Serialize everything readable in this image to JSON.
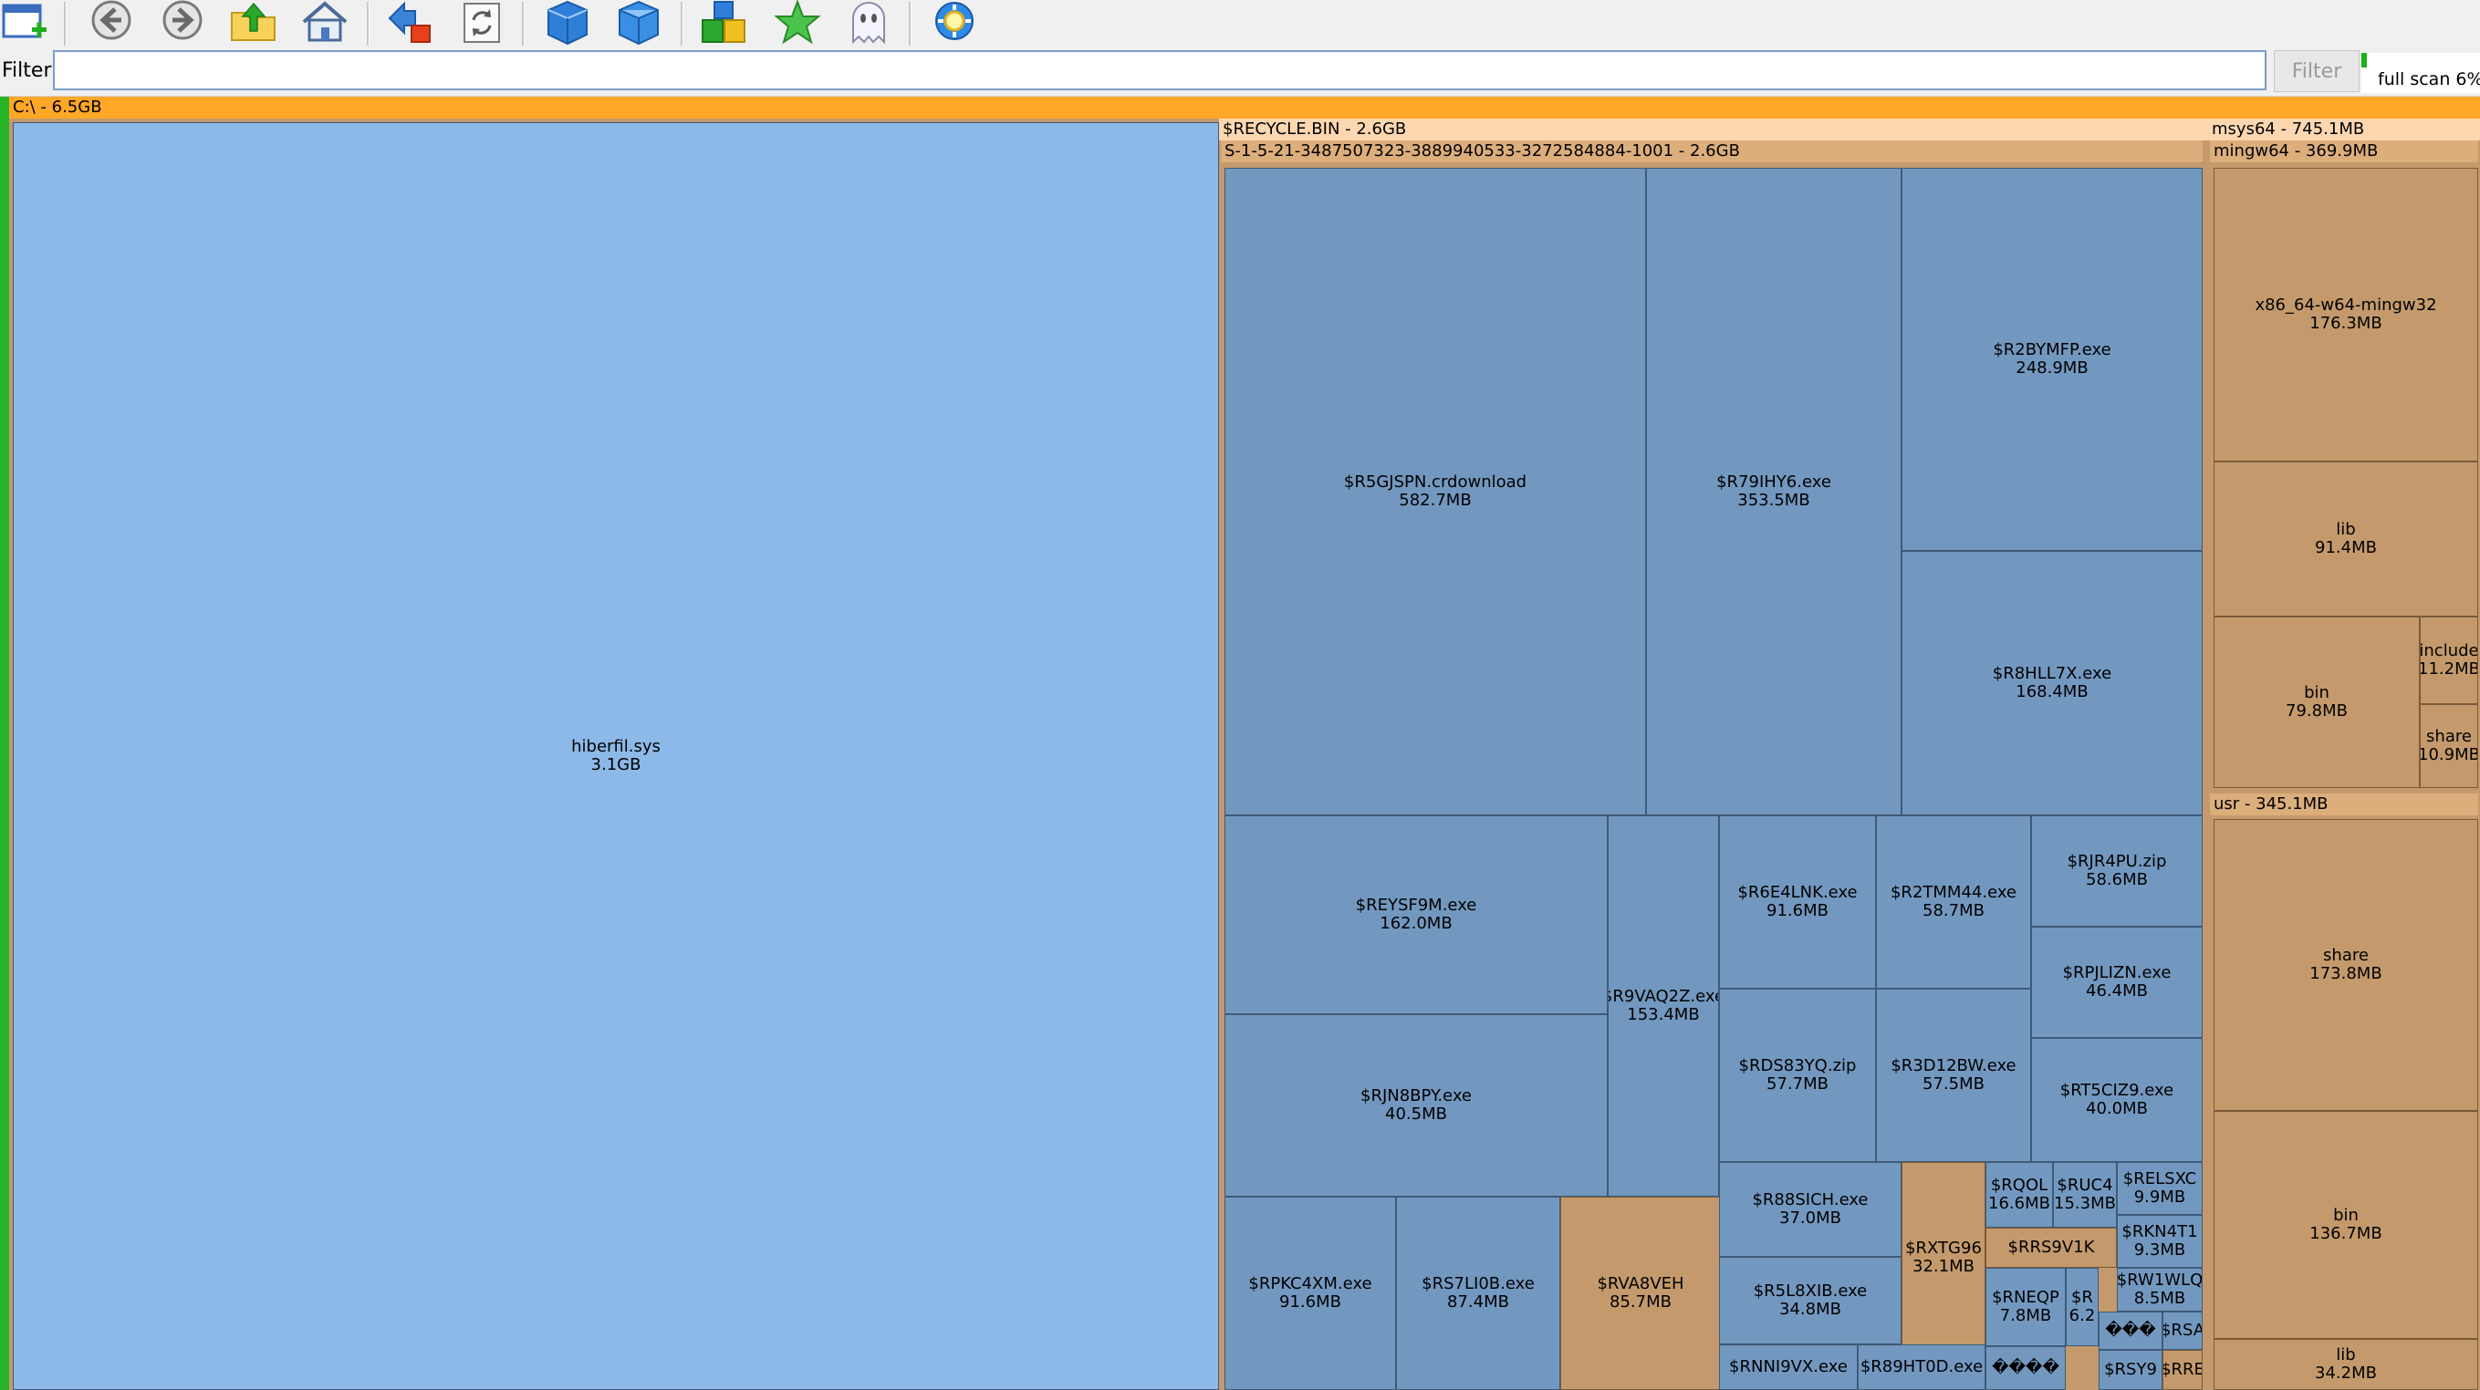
{
  "toolbar": {
    "buttons": [
      {
        "name": "new-window-button",
        "icon": "new-window-icon"
      },
      {
        "name": "back-button",
        "icon": "back-arrow-icon"
      },
      {
        "name": "forward-button",
        "icon": "forward-arrow-icon"
      },
      {
        "name": "up-button",
        "icon": "folder-up-icon"
      },
      {
        "name": "home-button",
        "icon": "home-icon"
      },
      {
        "name": "zoom-button",
        "icon": "zoom-icon"
      },
      {
        "name": "refresh-button",
        "icon": "refresh-icon"
      },
      {
        "name": "blue-cube-button",
        "icon": "cube-icon"
      },
      {
        "name": "blue-cube-open-button",
        "icon": "cube-open-icon"
      },
      {
        "name": "blocks-button",
        "icon": "blocks-icon"
      },
      {
        "name": "favorites-button",
        "icon": "star-icon"
      },
      {
        "name": "ghost-button",
        "icon": "ghost-icon"
      },
      {
        "name": "settings-button",
        "icon": "gear-icon"
      }
    ]
  },
  "filter": {
    "label": "Filter",
    "value": "",
    "placeholder": "",
    "button_label": "Filter"
  },
  "scan": {
    "label": "full scan 6%",
    "progress": 0.06
  },
  "colors": {
    "file_blue": "#8cb9e8",
    "folder_file_blue": "#7398c0",
    "tan": "#c49a6c",
    "header_orange": "#ffa726",
    "header_light": "#fdd7b0",
    "scan_green": "#19b219"
  },
  "treemap": {
    "root_header": "C:\\ - 6.5GB",
    "recycle_header": "$RECYCLE.BIN - 2.6GB",
    "sid_header": "S-1-5-21-3487507323-3889940533-3272584884-1001 - 2.6GB",
    "msys_header": "msys64 - 745.1MB",
    "mingw_header": "mingw64 - 369.9MB",
    "usr_header": "usr - 345.1MB",
    "cells": [
      {
        "name": "hiberfil.sys",
        "size": "3.1GB",
        "color": "blue"
      },
      {
        "name": "$R5GJSPN.crdownload",
        "size": "582.7MB",
        "color": "steel"
      },
      {
        "name": "$R79IHY6.exe",
        "size": "353.5MB",
        "color": "steel"
      },
      {
        "name": "$R2BYMFP.exe",
        "size": "248.9MB",
        "color": "steel"
      },
      {
        "name": "$R8HLL7X.exe",
        "size": "168.4MB",
        "color": "steel"
      },
      {
        "name": "$REYSF9M.exe",
        "size": "162.0MB",
        "color": "steel"
      },
      {
        "name": "$R9VAQ2Z.exe",
        "size": "153.4MB",
        "color": "steel"
      },
      {
        "name": "$R6E4LNK.exe",
        "size": "91.6MB",
        "color": "steel"
      },
      {
        "name": "$R2TMM44.exe",
        "size": "58.7MB",
        "color": "steel"
      },
      {
        "name": "$RJR4PU.zip",
        "size": "58.6MB",
        "color": "steel"
      },
      {
        "name": "$RPJLIZN.exe",
        "size": "46.4MB",
        "color": "steel"
      },
      {
        "name": "$RJN8BPY.exe",
        "size": "40.5MB",
        "color": "steel"
      },
      {
        "name": "$RDS83YQ.zip",
        "size": "57.7MB",
        "color": "steel"
      },
      {
        "name": "$R3D12BW.exe",
        "size": "57.5MB",
        "color": "steel"
      },
      {
        "name": "$RT5CIZ9.exe",
        "size": "40.0MB",
        "color": "steel"
      },
      {
        "name": "$RPKC4XM.exe",
        "size": "91.6MB",
        "color": "steel"
      },
      {
        "name": "$RS7LI0B.exe",
        "size": "87.4MB",
        "color": "steel"
      },
      {
        "name": "$RVA8VEH",
        "size": "85.7MB",
        "color": "tan"
      },
      {
        "name": "$R88SICH.exe",
        "size": "37.0MB",
        "color": "steel"
      },
      {
        "name": "$RXTG96",
        "size": "32.1MB",
        "color": "tan"
      },
      {
        "name": "$RQOL",
        "size": "16.6MB",
        "color": "steel"
      },
      {
        "name": "$RUC4",
        "size": "15.3MB",
        "color": "steel"
      },
      {
        "name": "$RELSXC",
        "size": "9.9MB",
        "color": "steel"
      },
      {
        "name": "$RKN4T1",
        "size": "9.3MB",
        "color": "steel"
      },
      {
        "name": "$R5L8XIB.exe",
        "size": "34.8MB",
        "color": "steel"
      },
      {
        "name": "$RRS9V1K",
        "size": "",
        "color": "tan"
      },
      {
        "name": "$RW1WLQ",
        "size": "8.5MB",
        "color": "steel"
      },
      {
        "name": "$RNEQP",
        "size": "7.8MB",
        "color": "steel"
      },
      {
        "name": "$R",
        "size": "6.2",
        "color": "steel"
      },
      {
        "name": "���",
        "size": "",
        "color": "steel"
      },
      {
        "name": "$RSA",
        "size": "",
        "color": "steel"
      },
      {
        "name": "$RSY9",
        "size": "",
        "color": "steel"
      },
      {
        "name": "$RRE",
        "size": "",
        "color": "tan"
      },
      {
        "name": "$RNNI9VX.exe",
        "size": "",
        "color": "steel"
      },
      {
        "name": "$R89HT0D.exe",
        "size": "",
        "color": "steel"
      },
      {
        "name": "����",
        "size": "",
        "color": "steel"
      },
      {
        "name": "x86_64-w64-mingw32",
        "size": "176.3MB",
        "color": "tan"
      },
      {
        "name": "lib",
        "size": "91.4MB",
        "color": "tan"
      },
      {
        "name": "bin",
        "size": "79.8MB",
        "color": "tan"
      },
      {
        "name": "include",
        "size": "11.2MB",
        "color": "tan"
      },
      {
        "name": "share",
        "size": "10.9MB",
        "color": "tan"
      },
      {
        "name": "share",
        "size": "173.8MB",
        "color": "tan"
      },
      {
        "name": "bin",
        "size": "136.7MB",
        "color": "tan"
      },
      {
        "name": "lib",
        "size": "34.2MB",
        "color": "tan"
      }
    ]
  }
}
